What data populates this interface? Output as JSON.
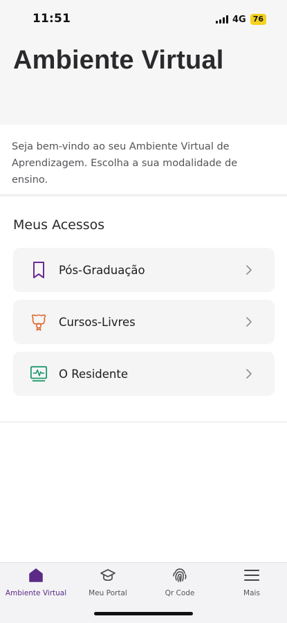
{
  "status_bar": {
    "time": "11:51",
    "network": "4G",
    "battery": "76"
  },
  "header": {
    "title": "Ambiente Virtual"
  },
  "intro": {
    "text": "Seja bem-vindo ao seu Ambiente Virtual de Aprendizagem. Escolha a sua modalidade de ensino."
  },
  "section": {
    "title": "Meus Acessos"
  },
  "access_items": [
    {
      "label": "Pós-Graduação",
      "icon": "bookmark-icon",
      "color": "#6a2a8f"
    },
    {
      "label": "Cursos-Livres",
      "icon": "certificate-icon",
      "color": "#e0662c"
    },
    {
      "label": "O Residente",
      "icon": "monitor-pulse-icon",
      "color": "#1f9a6b"
    }
  ],
  "tab_bar": {
    "tabs": [
      {
        "label": "Ambiente Virtual",
        "icon": "home-icon",
        "active": true
      },
      {
        "label": "Meu Portal",
        "icon": "graduation-cap-icon",
        "active": false
      },
      {
        "label": "Qr Code",
        "icon": "fingerprint-icon",
        "active": false
      },
      {
        "label": "Mais",
        "icon": "menu-icon",
        "active": false
      }
    ]
  },
  "colors": {
    "brand": "#5b2a86",
    "background": "#f6f6f7"
  }
}
